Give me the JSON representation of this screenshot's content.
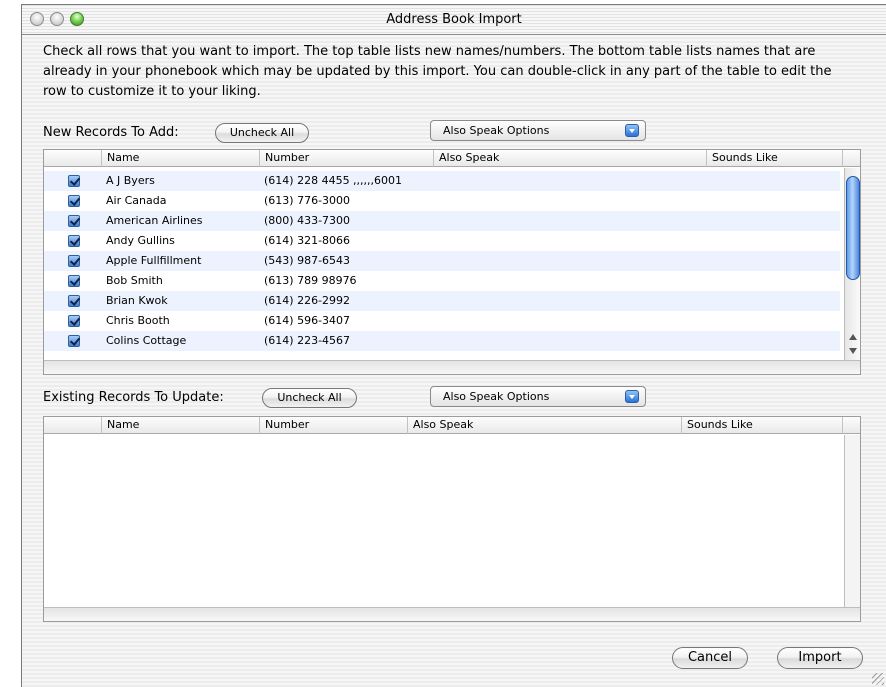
{
  "window": {
    "title": "Address Book Import"
  },
  "description": "Check all rows that you want to import.  The top table lists new names/numbers.  The bottom table lists names that are already in your phonebook which may be updated by this import.  You can double-click in any part of the table to edit the row to customize it to your liking.",
  "new_section": {
    "label": "New Records To Add:",
    "uncheck_label": "Uncheck All",
    "popup_label": "Also Speak Options",
    "columns": [
      "Name",
      "Number",
      "Also Speak",
      "Sounds Like"
    ],
    "rows": [
      {
        "name": "A J Byers",
        "number": "(614) 228 4455 ,,,,,,6001",
        "checked": true
      },
      {
        "name": "Air Canada",
        "number": "(613) 776-3000",
        "checked": true
      },
      {
        "name": "American Airlines",
        "number": "(800) 433-7300",
        "checked": true
      },
      {
        "name": "Andy Gullins",
        "number": "(614) 321-8066",
        "checked": true
      },
      {
        "name": "Apple Fullfillment",
        "number": "(543) 987-6543",
        "checked": true
      },
      {
        "name": "Bob Smith",
        "number": "(613) 789 98976",
        "checked": true
      },
      {
        "name": "Brian Kwok",
        "number": "(614) 226-2992",
        "checked": true
      },
      {
        "name": "Chris Booth",
        "number": "(614) 596-3407",
        "checked": true
      },
      {
        "name": "Colins Cottage",
        "number": "(614) 223-4567",
        "checked": true
      }
    ]
  },
  "existing_section": {
    "label": "Existing Records To Update:",
    "uncheck_label": "Uncheck All",
    "popup_label": "Also Speak Options",
    "columns": [
      "Name",
      "Number",
      "Also Speak",
      "Sounds Like"
    ]
  },
  "buttons": {
    "cancel": "Cancel",
    "import": "Import"
  },
  "colors": {
    "accent": "#3f7fd6",
    "row_alt": "#edf3fe"
  }
}
